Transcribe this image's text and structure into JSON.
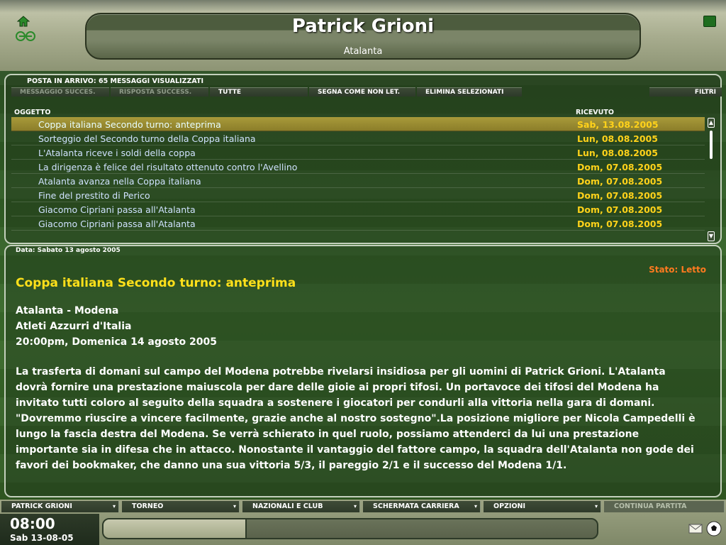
{
  "header": {
    "manager_name": "Patrick Grioni",
    "club_name": "Atalanta",
    "icons": [
      "home-icon",
      "link-icon",
      "search-icon"
    ]
  },
  "inbox": {
    "title": "POSTA IN ARRIVO: 65 MESSAGGI VISUALIZZATI",
    "toolbar": {
      "next_message": "MESSAGGIO SUCCES.",
      "next_reply": "RISPOSTA SUCCESS.",
      "all": "TUTTE",
      "mark_unread": "SEGNA COME NON LET.",
      "delete_selected": "ELIMINA SELEZIONATI",
      "filters": "FILTRI"
    },
    "columns": {
      "subject": "OGGETTO",
      "received": "RICEVUTO"
    },
    "messages": [
      {
        "subject": "Coppa italiana Secondo turno: anteprima",
        "date": "Sab, 13.08.2005"
      },
      {
        "subject": "Sorteggio del Secondo turno della Coppa italiana",
        "date": "Lun, 08.08.2005"
      },
      {
        "subject": "L'Atalanta riceve i soldi della coppa",
        "date": "Lun, 08.08.2005"
      },
      {
        "subject": "La dirigenza è felice del risultato ottenuto contro l'Avellino",
        "date": "Dom, 07.08.2005"
      },
      {
        "subject": "Atalanta avanza nella Coppa italiana",
        "date": "Dom, 07.08.2005"
      },
      {
        "subject": "Fine del prestito di Perico",
        "date": "Dom, 07.08.2005"
      },
      {
        "subject": "Giacomo Cipriani passa all'Atalanta",
        "date": "Dom, 07.08.2005"
      },
      {
        "subject": "Giacomo Cipriani passa all'Atalanta",
        "date": "Dom, 07.08.2005"
      }
    ]
  },
  "message": {
    "date_label": "Data: Sabato 13 agosto 2005",
    "status": "Stato: Letto",
    "title": "Coppa italiana Secondo turno: anteprima",
    "match": "Atalanta - Modena",
    "stadium": "Atleti Azzurri d'Italia",
    "kickoff": "20:00pm, Domenica 14 agosto 2005",
    "body": "La trasferta di domani sul campo del Modena potrebbe rivelarsi insidiosa per gli uomini di Patrick Grioni. L'Atalanta dovrà fornire una prestazione maiuscola per dare delle gioie ai propri tifosi. Un portavoce dei tifosi del Modena ha invitato tutti coloro al seguito della squadra a sostenere i giocatori per condurli alla vittoria nella gara di domani. \"Dovremmo riuscire a vincere facilmente, grazie anche al nostro sostegno\".La posizione migliore per Nicola Campedelli è lungo la fascia destra del Modena. Se verrà schierato in quel ruolo, possiamo attenderci da lui una prestazione importante sia in difesa che in attacco. Nonostante il vantaggio del fattore campo, la squadra dell'Atalanta non gode dei favori dei bookmaker, che danno una sua vittoria 5/3, il pareggio 2/1 e il successo del Modena 1/1."
  },
  "bottom_nav": {
    "items": [
      "PATRICK GRIONI",
      "TORNEO",
      "NAZIONALI E CLUB",
      "SCHERMATA CARRIERA",
      "OPZIONI"
    ],
    "continue": "CONTINUA PARTITA",
    "time": "08:00",
    "date": "Sab 13-08-05",
    "progress": 0.29,
    "icons": [
      "envelope-icon",
      "football-icon"
    ]
  },
  "colors": {
    "accent_yellow": "#ffe01a",
    "date_yellow": "#ffd21a",
    "status_orange": "#ff7a1f",
    "subject_blue": "#d0e2ff"
  }
}
